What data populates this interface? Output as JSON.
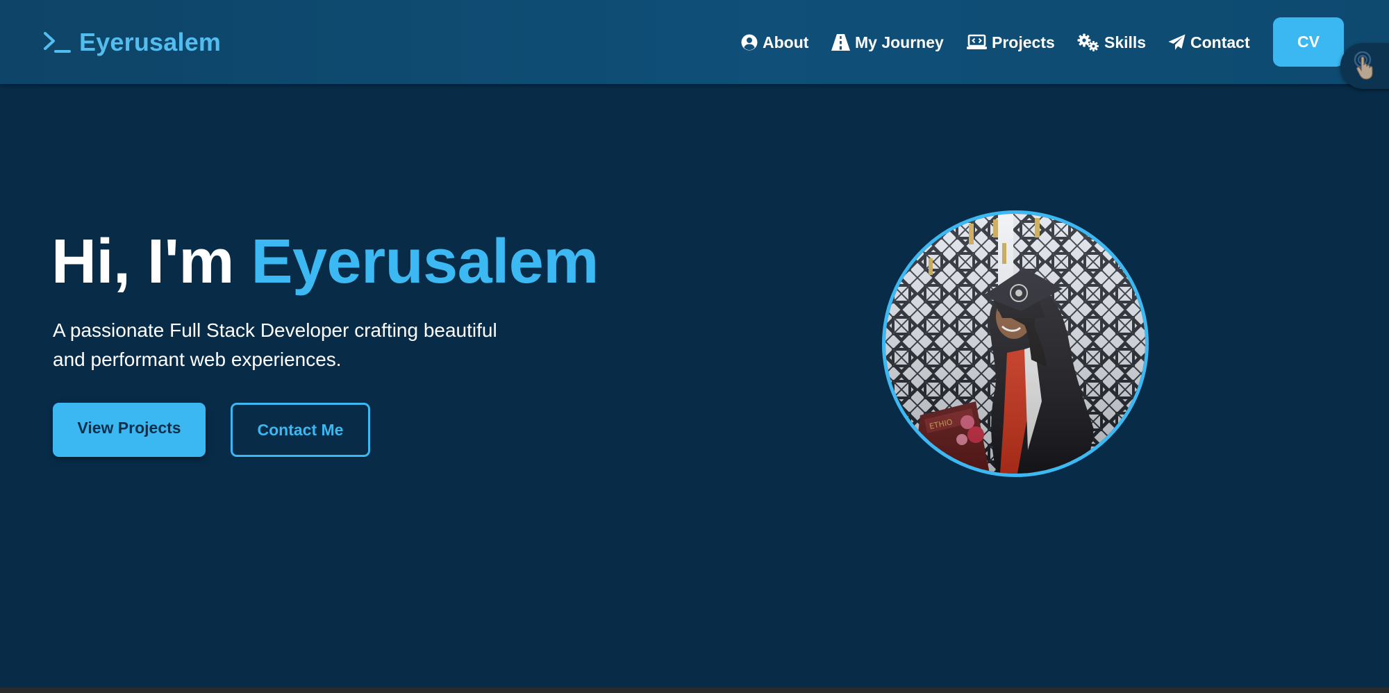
{
  "brand": {
    "icon": "terminal-icon",
    "name": "Eyerusalem"
  },
  "nav": {
    "items": [
      {
        "label": "About",
        "icon": "user-circle-icon"
      },
      {
        "label": "My Journey",
        "icon": "road-icon"
      },
      {
        "label": "Projects",
        "icon": "laptop-code-icon"
      },
      {
        "label": "Skills",
        "icon": "gears-icon"
      },
      {
        "label": "Contact",
        "icon": "paper-plane-icon"
      }
    ],
    "cv_label": "CV",
    "floating_icon": "hand-pointer-icon"
  },
  "hero": {
    "greeting": "Hi, I'm",
    "name": "Eyerusalem",
    "subtitle": "A passionate Full Stack Developer crafting beautiful and performant web experiences.",
    "primary_button": "View Projects",
    "secondary_button": "Contact Me",
    "photo": "graduation-portrait"
  },
  "colors": {
    "background": "#082c48",
    "navbar": "#0f4f78",
    "accent": "#3bb8f2",
    "brand_text": "#53bdf0"
  }
}
